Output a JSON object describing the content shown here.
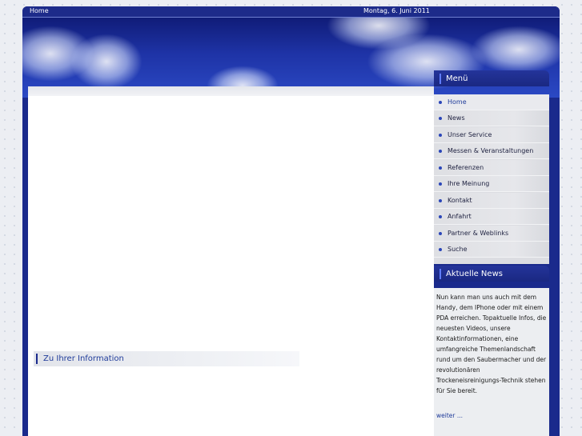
{
  "topbar": {
    "breadcrumb": "Home",
    "date": "Montag, 6. Juni 2011"
  },
  "content": {
    "info_heading": "Zu Ihrer Information"
  },
  "sidebar": {
    "menu_title": "Menü",
    "menu_items": [
      {
        "label": "Home",
        "active": true
      },
      {
        "label": "News"
      },
      {
        "label": "Unser Service"
      },
      {
        "label": "Messen & Veranstaltungen"
      },
      {
        "label": "Referenzen"
      },
      {
        "label": "Ihre Meinung"
      },
      {
        "label": "Kontakt"
      },
      {
        "label": "Anfahrt"
      },
      {
        "label": "Partner & Weblinks"
      },
      {
        "label": "Suche"
      }
    ],
    "news_title": "Aktuelle News",
    "news_text": "Nun kann man uns auch mit dem Handy, dem IPhone oder mit einem PDA erreichen. Topaktuelle Infos, die neuesten Videos, unsere Kontaktinformationen, eine umfangreiche Themenlandschaft rund um den Saubermacher und der revolutionären Trockeneisreinigungs-Technik stehen für Sie bereit.",
    "news_more": "weiter ..."
  },
  "colors": {
    "frame": "#1a2a8c",
    "accent": "#1f3b9a",
    "menu_bg": "#dcdde2"
  }
}
